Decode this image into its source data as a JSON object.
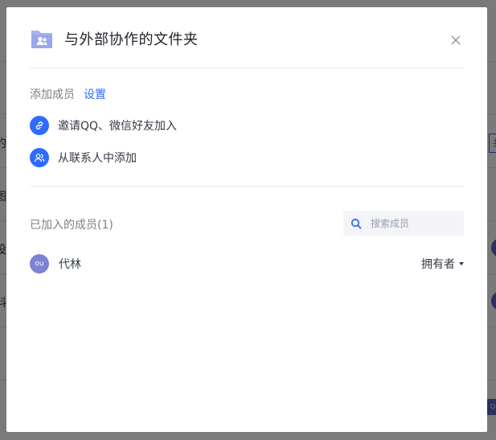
{
  "background": {
    "row_texts": [
      "的",
      "图",
      "设",
      "料"
    ],
    "tag_text": "共",
    "chip_text": "OU"
  },
  "dialog": {
    "title": "与外部协作的文件夹",
    "close_icon": "close-icon",
    "folder_icon": "folder-people-icon",
    "add_members_label": "添加成员",
    "settings_link": "设置",
    "invite_options": [
      {
        "icon": "link-icon",
        "label": "邀请QQ、微信好友加入"
      },
      {
        "icon": "contacts-icon",
        "label": "从联系人中添加"
      }
    ],
    "joined_members_label": "已加入的成员(1)",
    "search": {
      "placeholder": "搜索成员",
      "icon": "search-icon"
    },
    "members": [
      {
        "avatar_text": "ou",
        "name": "代林",
        "role": "拥有者"
      }
    ],
    "colors": {
      "accent": "#2f6bff",
      "avatar": "#7c83d4",
      "folder_icon": "#a8b4ef"
    }
  }
}
